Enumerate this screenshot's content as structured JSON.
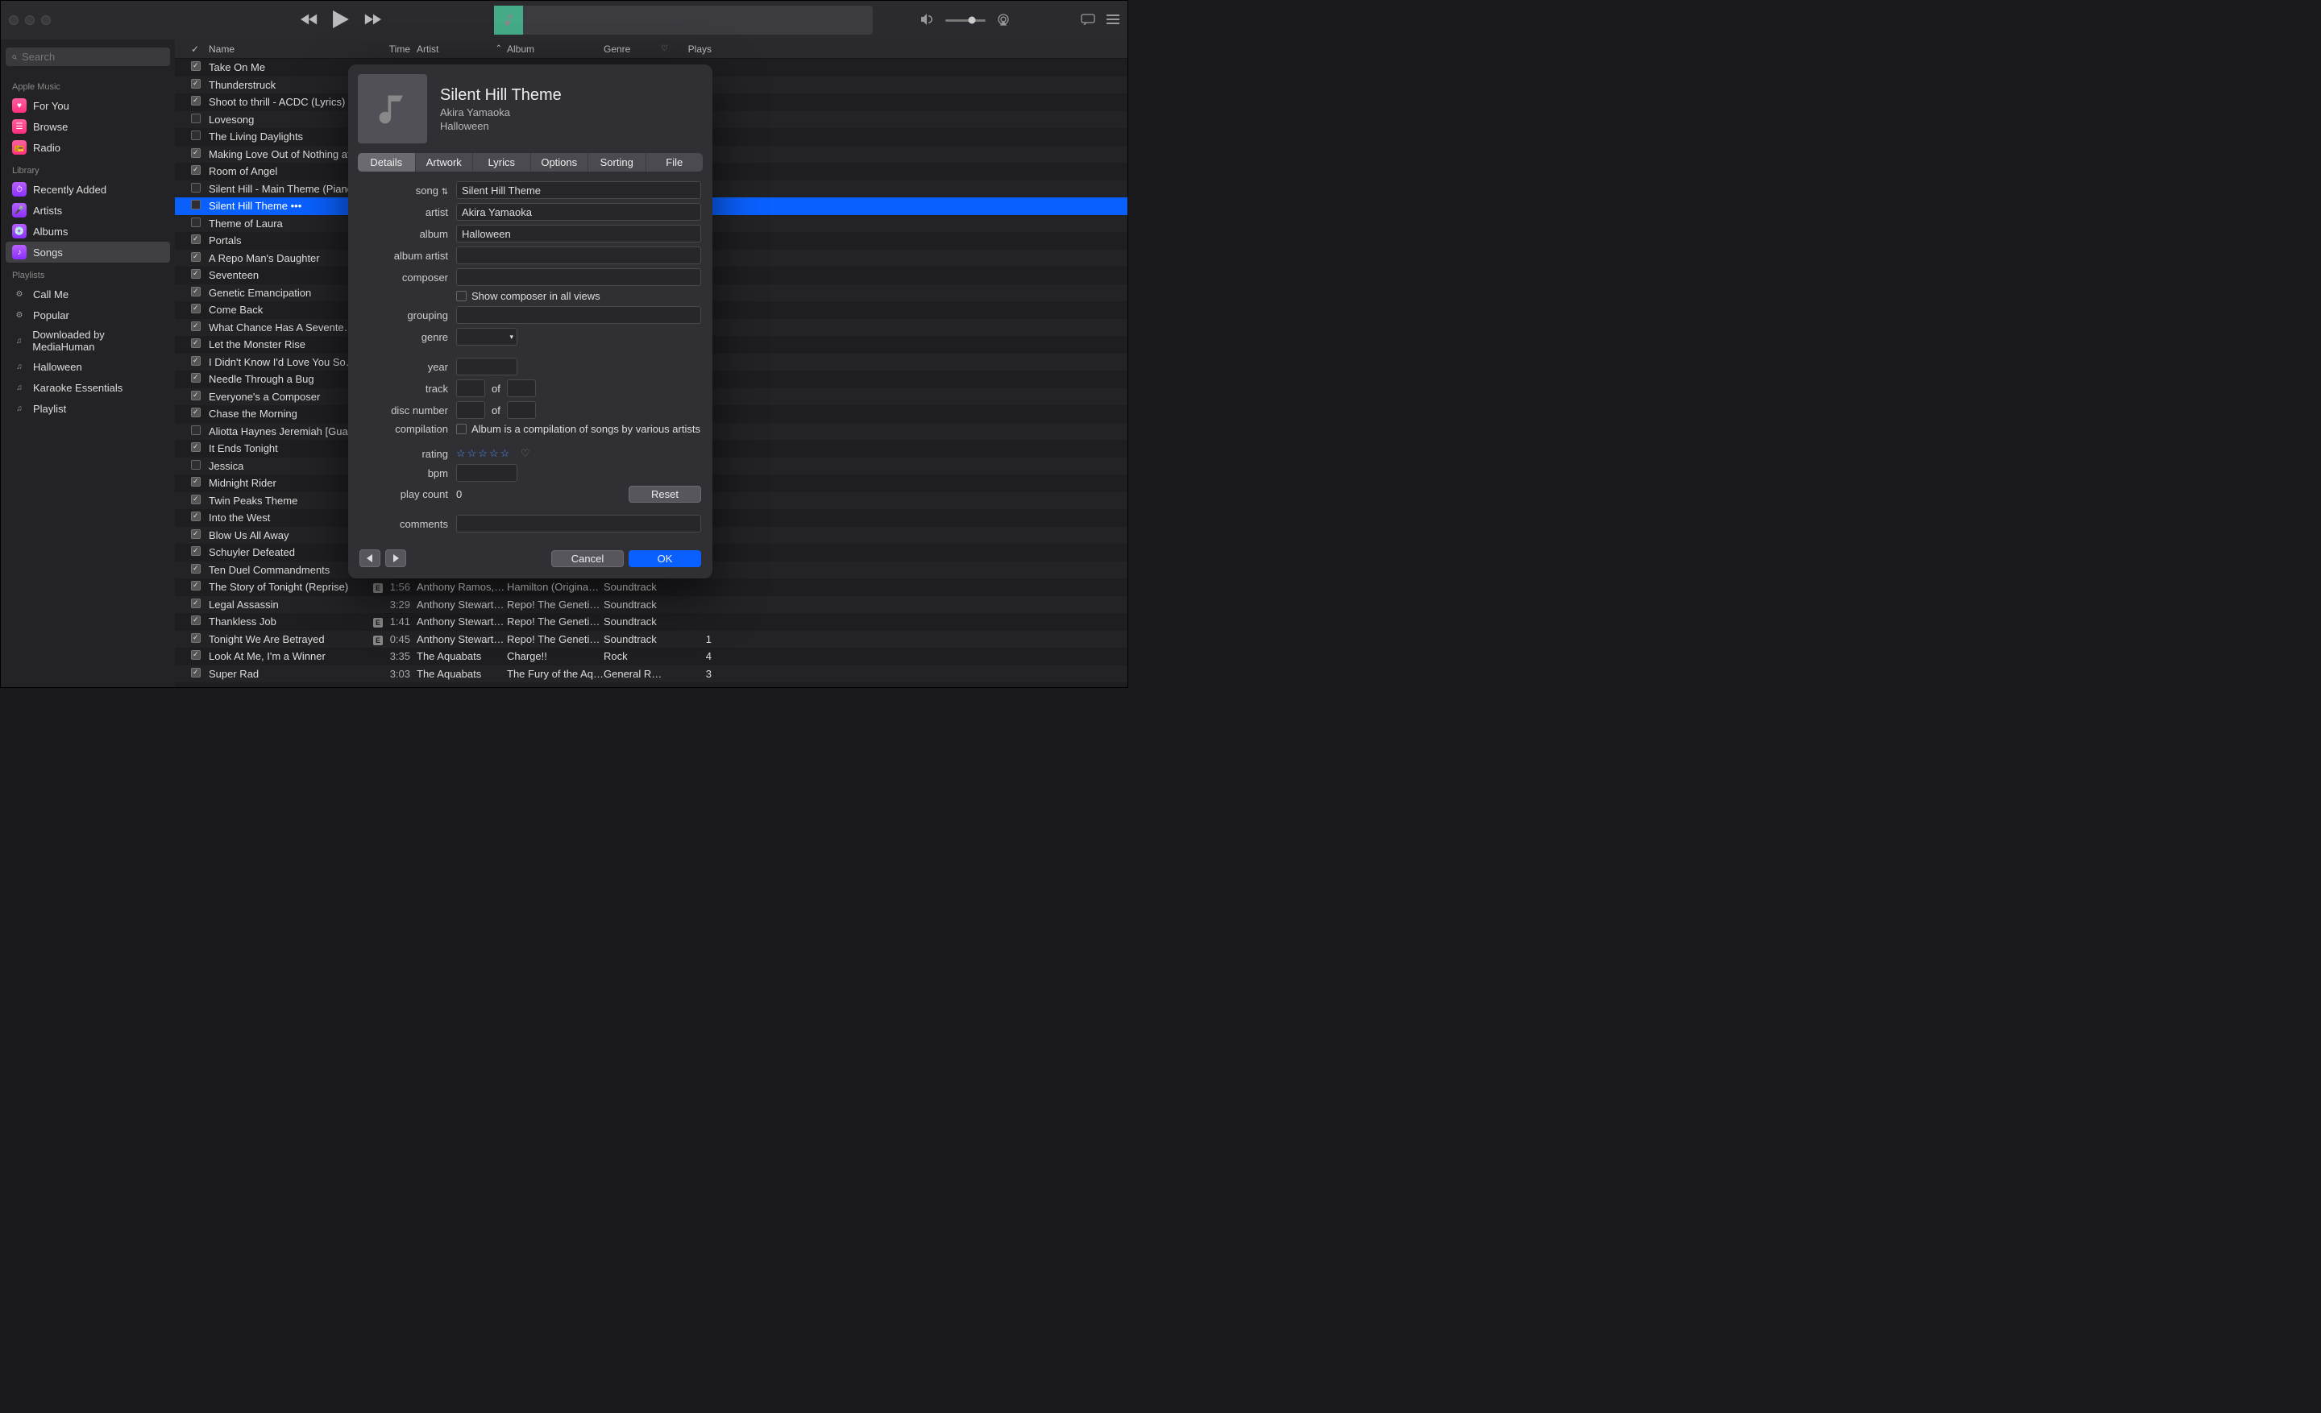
{
  "search": {
    "placeholder": "Search"
  },
  "sidebar": {
    "apple_music_label": "Apple Music",
    "apple_music": [
      {
        "label": "For You"
      },
      {
        "label": "Browse"
      },
      {
        "label": "Radio"
      }
    ],
    "library_label": "Library",
    "library": [
      {
        "label": "Recently Added"
      },
      {
        "label": "Artists"
      },
      {
        "label": "Albums"
      },
      {
        "label": "Songs"
      }
    ],
    "playlists_label": "Playlists",
    "playlists": [
      {
        "label": "Call Me"
      },
      {
        "label": "Popular"
      },
      {
        "label": "Downloaded by MediaHuman"
      },
      {
        "label": "Halloween"
      },
      {
        "label": "Karaoke Essentials"
      },
      {
        "label": "Playlist"
      }
    ]
  },
  "columns": {
    "name": "Name",
    "time": "Time",
    "artist": "Artist",
    "album": "Album",
    "genre": "Genre",
    "plays": "Plays"
  },
  "tracks": [
    {
      "checked": true,
      "name": "Take On Me"
    },
    {
      "checked": true,
      "name": "Thunderstruck"
    },
    {
      "checked": true,
      "name": "Shoot to thrill - ACDC (Lyrics)"
    },
    {
      "checked": false,
      "name": "Lovesong"
    },
    {
      "checked": false,
      "name": "The Living Daylights"
    },
    {
      "checked": true,
      "name": "Making Love Out of Nothing at …"
    },
    {
      "checked": true,
      "name": "Room of Angel"
    },
    {
      "checked": false,
      "name": "Silent Hill - Main Theme (Piano…"
    },
    {
      "checked": false,
      "name": "Silent Hill Theme •••",
      "selected": true
    },
    {
      "checked": false,
      "name": "Theme of Laura"
    },
    {
      "checked": true,
      "name": "Portals"
    },
    {
      "checked": true,
      "name": "A Repo Man's Daughter"
    },
    {
      "checked": true,
      "name": "Seventeen"
    },
    {
      "checked": true,
      "name": "Genetic Emancipation"
    },
    {
      "checked": true,
      "name": "Come Back"
    },
    {
      "checked": true,
      "name": "What Chance Has A Sevente…"
    },
    {
      "checked": true,
      "name": "Let the Monster Rise"
    },
    {
      "checked": true,
      "name": "I Didn't Know I'd Love You So…"
    },
    {
      "checked": true,
      "name": "Needle Through a Bug"
    },
    {
      "checked": true,
      "name": "Everyone's a Composer"
    },
    {
      "checked": true,
      "name": "Chase the Morning"
    },
    {
      "checked": false,
      "name": "Aliotta Haynes Jeremiah [Guarc…"
    },
    {
      "checked": true,
      "name": "It Ends Tonight"
    },
    {
      "checked": false,
      "name": "Jessica"
    },
    {
      "checked": true,
      "name": "Midnight Rider"
    },
    {
      "checked": true,
      "name": "Twin Peaks Theme"
    },
    {
      "checked": true,
      "name": "Into the West"
    },
    {
      "checked": true,
      "name": "Blow Us All Away"
    },
    {
      "checked": true,
      "name": "Schuyler Defeated"
    },
    {
      "checked": true,
      "name": "Ten Duel Commandments"
    },
    {
      "checked": true,
      "name": "The Story of Tonight (Reprise)",
      "explicit": true,
      "time": "1:56",
      "artist": "Anthony Ramos, O…",
      "album": "Hamilton (Origina…",
      "genre": "Soundtrack"
    },
    {
      "checked": true,
      "name": "Legal Assassin",
      "time": "3:29",
      "artist": "Anthony Stewart…",
      "album": "Repo! The Genetic…",
      "genre": "Soundtrack"
    },
    {
      "checked": true,
      "name": "Thankless Job",
      "explicit": true,
      "time": "1:41",
      "artist": "Anthony Stewart…",
      "album": "Repo! The Genetic…",
      "genre": "Soundtrack"
    },
    {
      "checked": true,
      "name": "Tonight We Are Betrayed",
      "explicit": true,
      "time": "0:45",
      "artist": "Anthony Stewart…",
      "album": "Repo! The Genetic…",
      "genre": "Soundtrack",
      "plays": "1"
    },
    {
      "checked": true,
      "name": "Look At Me, I'm a Winner",
      "time": "3:35",
      "artist": "The Aquabats",
      "album": "Charge!!",
      "genre": "Rock",
      "plays": "4"
    },
    {
      "checked": true,
      "name": "Super Rad",
      "time": "3:03",
      "artist": "The Aquabats",
      "album": "The Fury of the Aq…",
      "genre": "General R…",
      "plays": "3"
    }
  ],
  "dialog": {
    "title": "Silent Hill Theme",
    "artist_line": "Akira Yamaoka",
    "album_line": "Halloween",
    "tabs": [
      "Details",
      "Artwork",
      "Lyrics",
      "Options",
      "Sorting",
      "File"
    ],
    "labels": {
      "song": "song",
      "artist": "artist",
      "album": "album",
      "album_artist": "album artist",
      "composer": "composer",
      "show_composer": "Show composer in all views",
      "grouping": "grouping",
      "genre": "genre",
      "year": "year",
      "track": "track",
      "of": "of",
      "disc_number": "disc number",
      "compilation": "compilation",
      "compilation_text": "Album is a compilation of songs by various artists",
      "rating": "rating",
      "bpm": "bpm",
      "play_count": "play count",
      "comments": "comments"
    },
    "values": {
      "song": "Silent Hill Theme",
      "artist": "Akira Yamaoka",
      "album": "Halloween",
      "album_artist": "",
      "composer": "",
      "grouping": "",
      "genre": "",
      "year": "",
      "track": "",
      "track_of": "",
      "disc": "",
      "disc_of": "",
      "bpm": "",
      "play_count": "0",
      "comments": ""
    },
    "stars": "☆☆☆☆☆",
    "reset": "Reset",
    "cancel": "Cancel",
    "ok": "OK"
  }
}
